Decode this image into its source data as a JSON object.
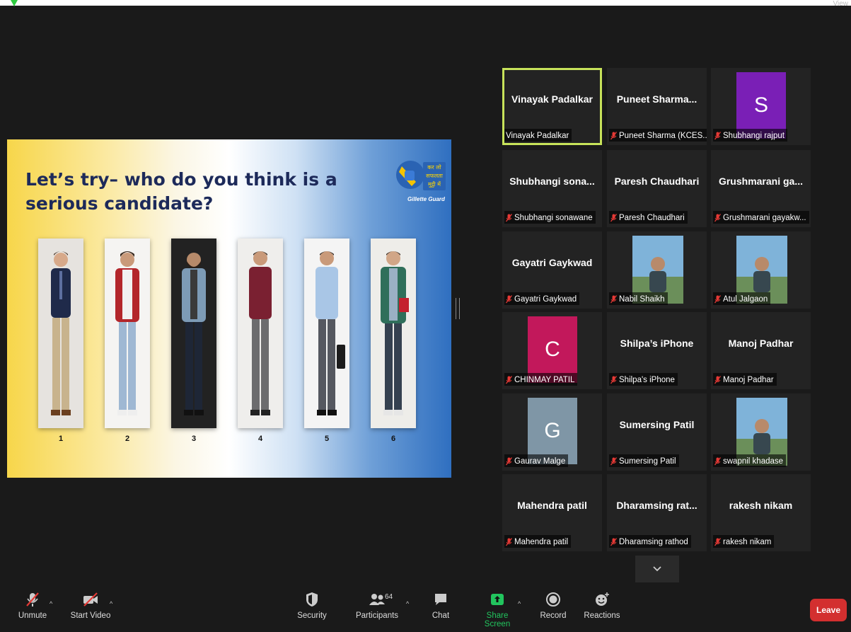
{
  "topbar": {
    "view_label": "View"
  },
  "slide": {
    "title": "Let’s try– who do you think is a serious candidate?",
    "logo_text": "कर लो सफलता मुट्ठी में",
    "logo_brand": "Gillette Guard",
    "numbers": [
      "1",
      "2",
      "3",
      "4",
      "5",
      "6"
    ]
  },
  "gallery": {
    "tiles": [
      {
        "name": "Vinayak Padalkar",
        "label": "Vinayak Padalkar",
        "muted": false,
        "active": true
      },
      {
        "name": "Puneet  Sharma...",
        "label": "Puneet Sharma (KCES...",
        "muted": true
      },
      {
        "name": "",
        "label": "Shubhangi rajput",
        "muted": true,
        "avatar": "S",
        "avatar_color": "#7a1fb6"
      },
      {
        "name": "Shubhangi  sona...",
        "label": "Shubhangi sonawane",
        "muted": true
      },
      {
        "name": "Paresh Chaudhari",
        "label": "Paresh Chaudhari",
        "muted": true
      },
      {
        "name": "Grushmarani  ga...",
        "label": "Grushmarani gayakw...",
        "muted": true
      },
      {
        "name": "Gayatri Gaykwad",
        "label": "Gayatri Gaykwad",
        "muted": true
      },
      {
        "name": "",
        "label": "Nabil Shaikh",
        "muted": true,
        "photo": true
      },
      {
        "name": "",
        "label": "Atul Jalgaon",
        "muted": true,
        "photo": true
      },
      {
        "name": "",
        "label": "CHINMAY PATIL",
        "muted": true,
        "avatar": "C",
        "avatar_color": "#c2185b"
      },
      {
        "name": "Shilpa’s iPhone",
        "label": "Shilpa's iPhone",
        "muted": true
      },
      {
        "name": "Manoj Padhar",
        "label": "Manoj Padhar",
        "muted": true
      },
      {
        "name": "",
        "label": "Gaurav Malge",
        "muted": true,
        "avatar": "G",
        "avatar_color": "#7f96a6"
      },
      {
        "name": "Sumersing Patil",
        "label": "Sumersing Patil",
        "muted": true
      },
      {
        "name": "",
        "label": "swapnil khadase",
        "muted": true,
        "photo": true
      },
      {
        "name": "Mahendra patil",
        "label": "Mahendra patil",
        "muted": true
      },
      {
        "name": "Dharamsing  rat...",
        "label": "Dharamsing rathod",
        "muted": true
      },
      {
        "name": "rakesh nikam",
        "label": "rakesh nikam",
        "muted": true
      }
    ]
  },
  "toolbar": {
    "unmute": "Unmute",
    "start_video": "Start Video",
    "security": "Security",
    "participants": "Participants",
    "participants_count": "64",
    "chat": "Chat",
    "share_screen": "Share Screen",
    "record": "Record",
    "reactions": "Reactions",
    "leave": "Leave"
  },
  "colors": {
    "active_border": "#c7e35a",
    "share_green": "#22c55e",
    "leave_red": "#d32f2f",
    "mute_red": "#e53935"
  }
}
